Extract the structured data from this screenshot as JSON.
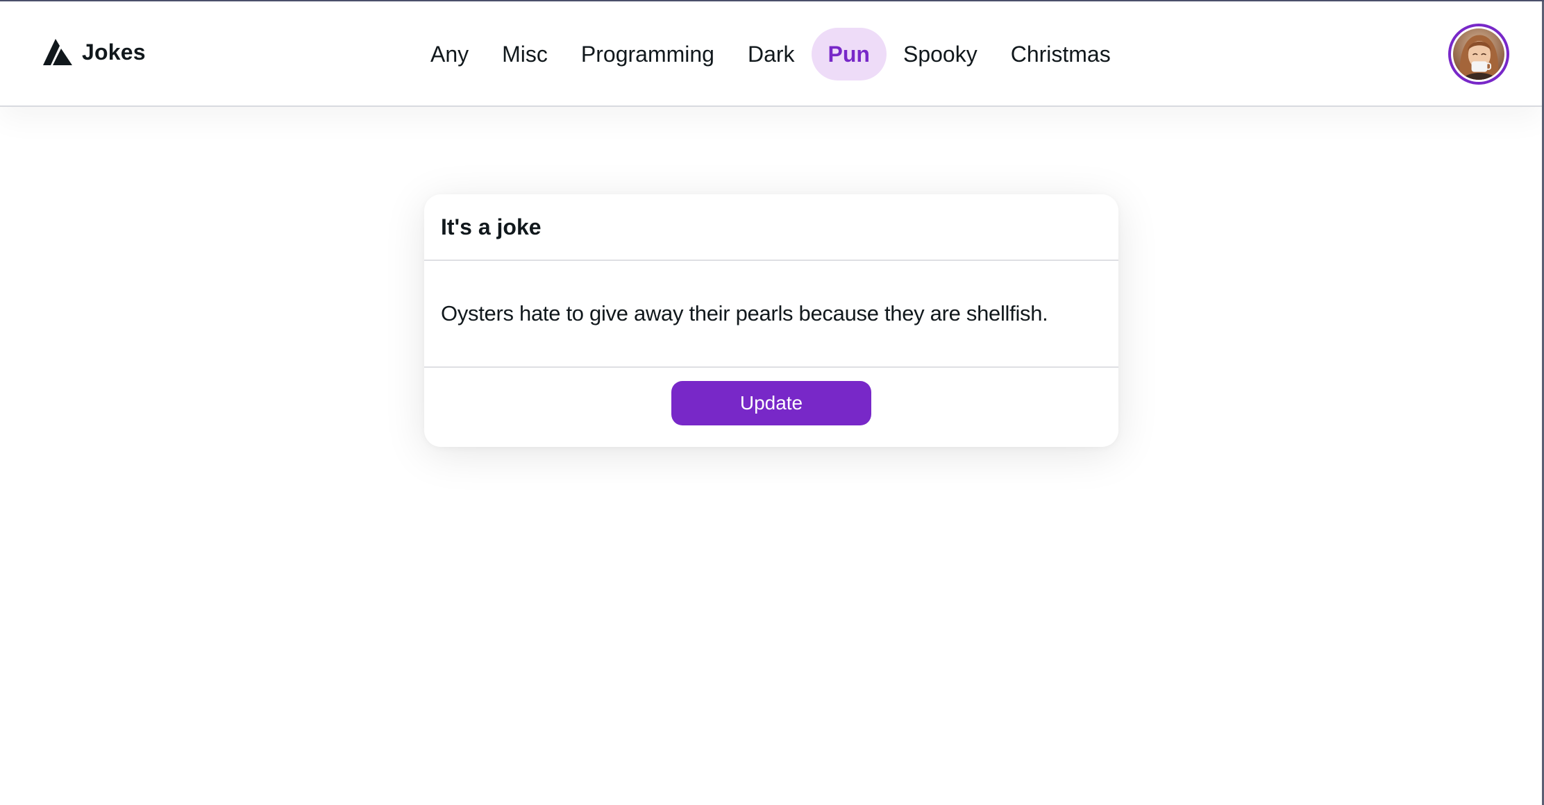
{
  "brand": {
    "name": "Jokes",
    "logo_icon": "triangle-logo-icon"
  },
  "nav": {
    "items": [
      {
        "label": "Any"
      },
      {
        "label": "Misc"
      },
      {
        "label": "Programming"
      },
      {
        "label": "Dark"
      },
      {
        "label": "Pun"
      },
      {
        "label": "Spooky"
      },
      {
        "label": "Christmas"
      }
    ],
    "active": "Pun"
  },
  "user": {
    "avatar_icon": "user-avatar"
  },
  "card": {
    "title": "It's a joke",
    "joke": "Oysters hate to give away their pearls because they are shellfish.",
    "button_label": "Update"
  },
  "colors": {
    "accent": "#7828c8",
    "accent_soft": "#eedcf8",
    "text": "#11181c",
    "divider": "#dedfe3"
  }
}
